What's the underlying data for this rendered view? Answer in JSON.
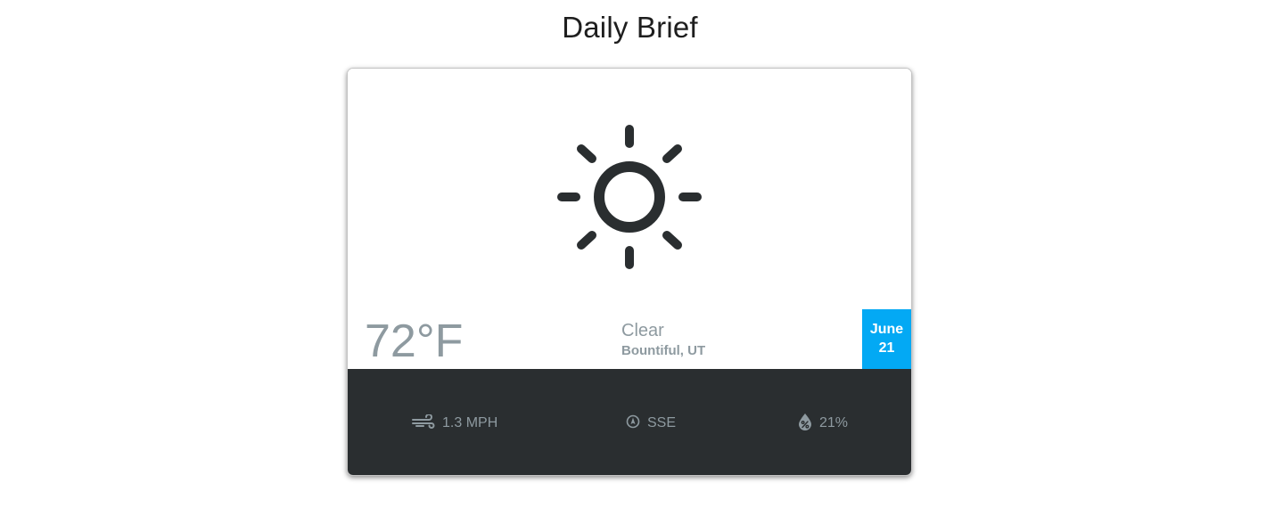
{
  "page": {
    "title": "Daily Brief"
  },
  "weather": {
    "icon": "sun-icon",
    "temperature": "72°F",
    "condition": "Clear",
    "location": "Bountiful, UT",
    "date": {
      "month": "June",
      "day": "21"
    }
  },
  "stats": {
    "wind_speed": "1.3 MPH",
    "wind_direction": "SSE",
    "humidity": "21%"
  },
  "colors": {
    "accent": "#03a9f4",
    "dark_panel": "#2a2e30",
    "muted_text": "#8e9aa0",
    "icon_dark": "#2a2e30"
  }
}
